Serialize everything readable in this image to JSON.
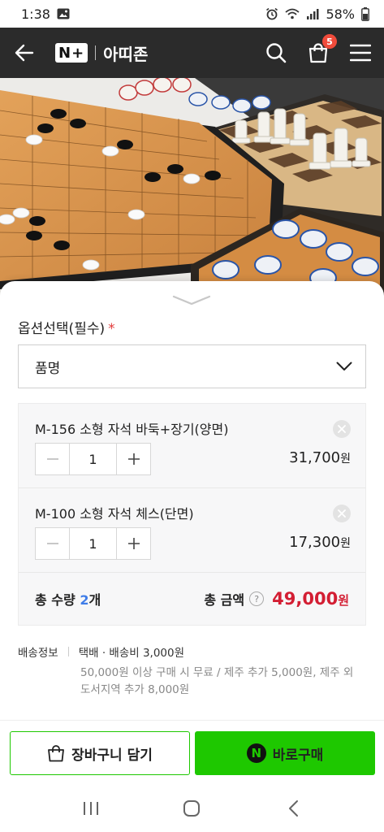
{
  "status_bar": {
    "time": "1:38",
    "battery": "58%"
  },
  "header": {
    "logo_box": "N+",
    "store_name": "아띠존",
    "cart_count": "5"
  },
  "options": {
    "title": "옵션선택(필수)",
    "required_mark": "*",
    "select_value": "품명"
  },
  "items": [
    {
      "name": "M-156 소형 자석 바둑+장기(양면)",
      "quantity": "1",
      "price": "31,700",
      "unit": "원"
    },
    {
      "name": "M-100 소형 자석 체스(단면)",
      "quantity": "1",
      "price": "17,300",
      "unit": "원"
    }
  ],
  "totals": {
    "quantity_label": "총 수량",
    "quantity_value": "2",
    "quantity_unit": "개",
    "amount_label": "총 금액",
    "help": "?",
    "amount_value": "49,000",
    "amount_unit": "원"
  },
  "shipping": {
    "label": "배송정보",
    "summary": "택배 · 배송비 3,000원",
    "detail": "50,000원 이상 구매 시 무료 / 제주 추가 5,000원, 제주 외 도서지역 추가 8,000원"
  },
  "actions": {
    "cart_label": "장바구니 담기",
    "buy_label": "바로구매",
    "buy_icon": "N"
  },
  "colors": {
    "naver_green": "#1ec800",
    "header_bg": "#2b2b2b",
    "price_red": "#d31e33",
    "badge_red": "#f04b3b",
    "count_blue": "#3f7de8"
  }
}
